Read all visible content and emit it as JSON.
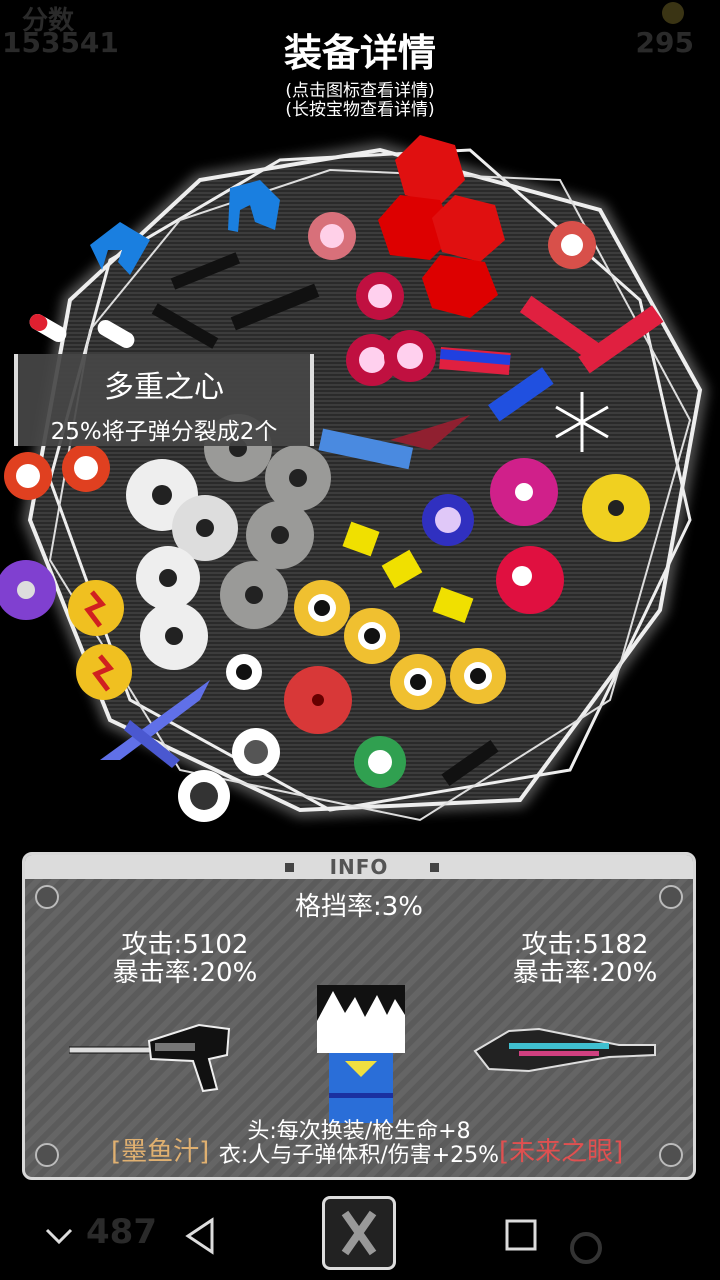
{
  "hud": {
    "score_label": "分数",
    "score": "153541",
    "coins": "295",
    "ammo": "487"
  },
  "header": {
    "title": "装备详情",
    "hint1": "(点击图标查看详情)",
    "hint2": "(长按宝物查看详情)"
  },
  "tooltip": {
    "name": "多重之心",
    "desc": "25%将子弹分裂成2个"
  },
  "info": {
    "title": "INFO",
    "block_rate": "格挡率:3%",
    "left_weapon": {
      "attack": "攻击:5102",
      "crit": "暴击率:20%",
      "name": "[墨鱼汁]"
    },
    "right_weapon": {
      "attack": "攻击:5182",
      "crit": "暴击率:20%",
      "name": "[未来之眼]"
    },
    "bonus_head": "头:每次换装/枪生命+8",
    "bonus_body": "衣:人与子弹体积/伤害+25%"
  },
  "colors": {
    "panel": "#606060",
    "left_name": "#e0b070",
    "right_name": "#e05050"
  }
}
